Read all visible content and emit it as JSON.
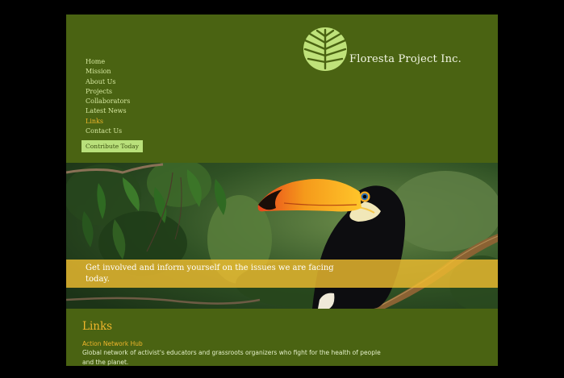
{
  "nav": {
    "items": [
      "Home",
      "Mission",
      "About Us",
      "Projects",
      "Collaborators",
      "Latest News",
      "Links",
      "Contact Us"
    ],
    "active": "Links"
  },
  "contribute_label": "Contribute Today",
  "brand_name": "Floresta Project Inc.",
  "hero": {
    "banner_text": "Get involved and inform yourself on the issues we are facing today."
  },
  "links_section": {
    "heading": "Links",
    "items": [
      {
        "title": "Action Network Hub",
        "description": "Global network of activist's educators and grassroots organizers who fight for the health of people and the planet."
      }
    ]
  },
  "colors": {
    "page_bg": "#4a6312",
    "nav_text": "#d6e8a0",
    "active": "#f0b62c",
    "button": "#b9e07b",
    "banner": "#eebc30"
  }
}
